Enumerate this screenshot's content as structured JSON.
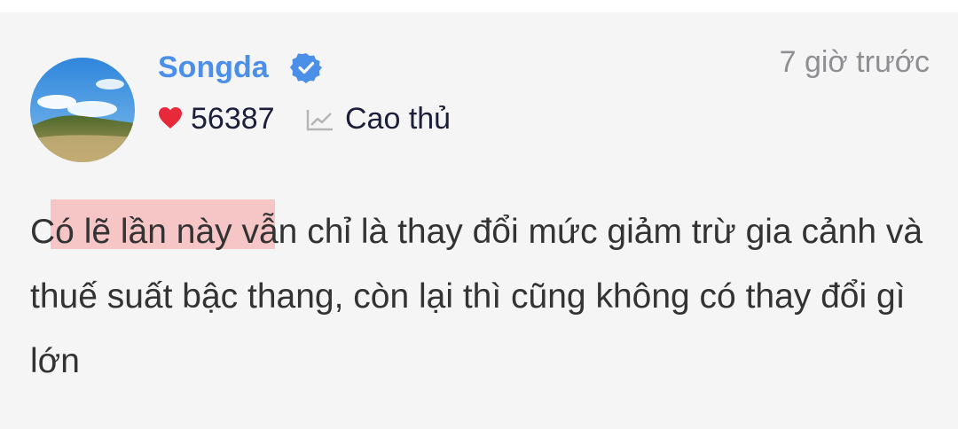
{
  "post": {
    "author": {
      "name": "Songda",
      "avatar_icon": "landscape-avatar-icon",
      "verified_icon": "verified-check-icon"
    },
    "timestamp": "7 giờ trước",
    "stats": {
      "likes": "56387",
      "like_icon": "heart-icon",
      "rank_icon": "trend-chart-icon",
      "rank": "Cao thủ"
    },
    "comment": "Có lẽ lần này vẫn chỉ là thay đổi mức giảm trừ gia cảnh và thuế suất bậc thang, còn lại thì cũng không có thay đổi gì lớn"
  },
  "colors": {
    "username": "#4b8fe8",
    "verified": "#4b8fe8",
    "heart": "#e8293a",
    "highlight": "#f6c6c6",
    "card_background": "#f5f5f5"
  }
}
